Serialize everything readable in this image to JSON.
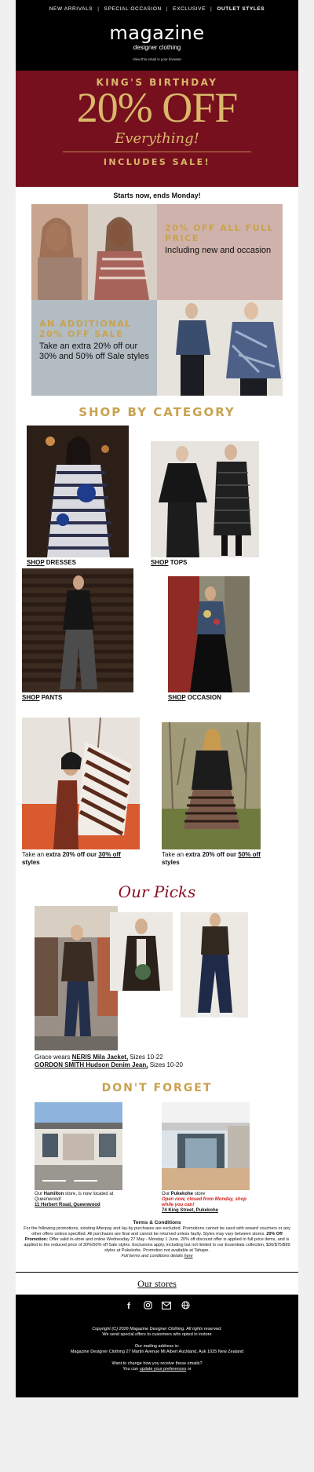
{
  "nav": {
    "items": [
      "NEW ARRIVALS",
      "SPECIAL OCCASION",
      "EXCLUSIVE",
      "OUTLET STYLES"
    ],
    "separator": "|"
  },
  "brand": {
    "logo": "magazine",
    "sub": "designer clothing",
    "view": "View this email in your browser"
  },
  "hero": {
    "kicker": "KING'S BIRTHDAY",
    "big": "20% OFF",
    "ev": "Everything!",
    "inc": "INCLUDES SALE!",
    "colors": {
      "bg": "#76101e",
      "gold": "#d9b86a"
    }
  },
  "starts": "Starts now, ends Monday!",
  "tiles": {
    "full_price": {
      "heading": "20% OFF ALL FULL PRICE",
      "body": "Including new and occasion"
    },
    "additional": {
      "heading": "AN ADDITIONAL 20% OFF SALE",
      "body": "Take an extra 20% off our 30% and 50% off Sale styles"
    }
  },
  "category": {
    "heading": "SHOP BY CATEGORY",
    "shop": "SHOP",
    "dresses": " DRESSES",
    "tops": " TOPS",
    "pants": " PANTS",
    "occasion": " OCCASION",
    "extra_pre": "Take an ",
    "extra_bold": "extra 20% off our ",
    "off30": "30% off",
    "off50": "50% off",
    "styles": " styles"
  },
  "picks": {
    "heading": "Our Picks",
    "wears": "Grace wears ",
    "item1": "NERIS Mila Jacket,",
    "size1": " Sizes 10-22",
    "item2": "GORDON SMITH Hudson Denim Jean,",
    "size2": " Sizes 10-20"
  },
  "stores": {
    "heading": "DON'T FORGET",
    "ham_our": "Our ",
    "ham_name": "Hamilton",
    "ham_rest": " store, is now located at Queenwood!",
    "ham_addr": "11 Herbert Road, Queenwood",
    "puk_name": "Pukekohe",
    "puk_rest": " store",
    "puk_open": "Open now, closed from Monday, shop while you can!",
    "puk_addr": "74 King Street, Pukekohe"
  },
  "terms": {
    "title": "Terms & Conditions",
    "body_a": "For the following promotions, existing Afterpay and lay-by purchases are excluded. Promotions cannot be used with reward vouchers or any other offers unless specified. All purchases are final and cannot be returned unless faulty. Styles may vary between stores. ",
    "promo_label": "20% Off Promotion:",
    "body_b": " Offer valid in-store and online Wednesday 27 May - Monday 1 June. 20% off discount offer is applied to full price items, and is applied to the reduced price of 30%/50% off Sale styles. Exclusions apply, including but not limited to our Essentials collection, $30/$75/$99 styles at Pukekohe. Promotion not available at Tahape.",
    "details": "Full terms and conditions details ",
    "here": "here"
  },
  "our_stores": "Our stores",
  "social": [
    "facebook-icon",
    "instagram-icon",
    "email-icon",
    "website-icon"
  ],
  "footer": {
    "copyright": "Copyright (C) 2026 Magazine Designer Clothing. All rights reserved.",
    "sent": "We send special offers to customers who opted in instore",
    "mail_label": "Our mailing address is:",
    "address": "Magazine Designer Clothing 27 Martin Avenue Mt Albert Auckland, Auk 1025 New Zealand",
    "change": "Want to change how you receive these emails?",
    "you_can": "You can ",
    "update": "update your preferences",
    "or": " or"
  }
}
